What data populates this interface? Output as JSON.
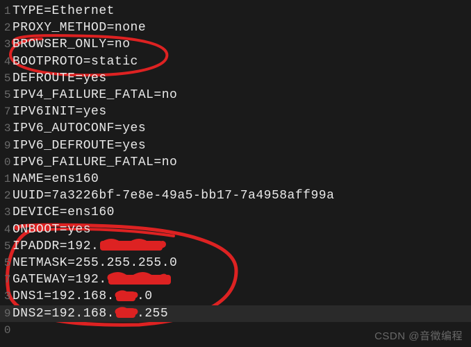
{
  "lines": [
    {
      "num": "1",
      "text": "TYPE=Ethernet"
    },
    {
      "num": "2",
      "text": "PROXY_METHOD=none"
    },
    {
      "num": "3",
      "text": "BROWSER_ONLY=no"
    },
    {
      "num": "4",
      "text": "BOOTPROTO=static"
    },
    {
      "num": "5",
      "text": "DEFROUTE=yes"
    },
    {
      "num": "5",
      "text": "IPV4_FAILURE_FATAL=no"
    },
    {
      "num": "7",
      "text": "IPV6INIT=yes"
    },
    {
      "num": "3",
      "text": "IPV6_AUTOCONF=yes"
    },
    {
      "num": "9",
      "text": "IPV6_DEFROUTE=yes"
    },
    {
      "num": "0",
      "text": "IPV6_FAILURE_FATAL=no"
    },
    {
      "num": "1",
      "text": "NAME=ens160"
    },
    {
      "num": "2",
      "text": "UUID=7a3226bf-7e8e-49a5-bb17-7a4958aff99a"
    },
    {
      "num": "3",
      "text": "DEVICE=ens160"
    },
    {
      "num": "4",
      "text": "ONBOOT=yes"
    },
    {
      "num": "5",
      "text": "IPADDR=192.",
      "redact_after": true,
      "redact_w": 90
    },
    {
      "num": "5",
      "text": "NETMASK=255.255.255.0"
    },
    {
      "num": "7",
      "text": "GATEWAY=192.",
      "redact_after": true,
      "redact_w": 90
    },
    {
      "num": "3",
      "text_parts": [
        "DNS1=192.168.",
        ".0"
      ],
      "redact_w": 28
    },
    {
      "num": "9",
      "text_parts": [
        "DNS2=192.168.",
        ".255"
      ],
      "redact_w": 28,
      "cursor": true
    },
    {
      "num": "0",
      "text": ""
    }
  ],
  "watermark": "CSDN @音徵编程",
  "annotations": {
    "color": "#d22",
    "top_circle": "encircles lines 3-4 (BROWSER_ONLY, BOOTPROTO)",
    "bottom_circle": "encircles lines 14-19 (ONBOOT through DNS2)"
  }
}
